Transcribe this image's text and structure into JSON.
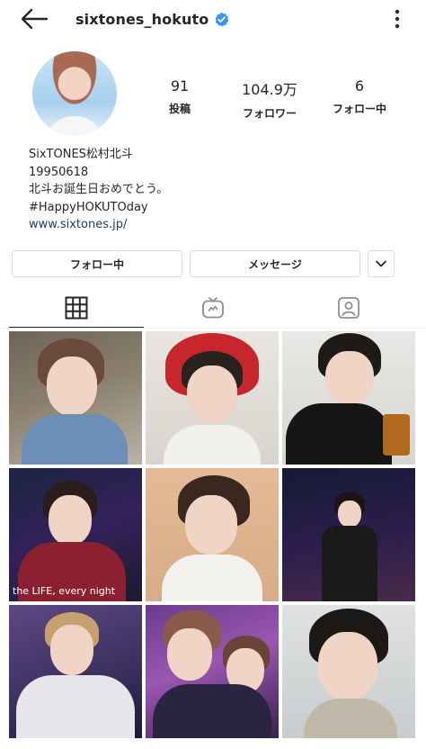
{
  "header": {
    "username": "sixtones_hokuto"
  },
  "stats": {
    "posts": {
      "value": "91",
      "label": "投稿"
    },
    "followers": {
      "value": "104.9万",
      "label": "フォロワー"
    },
    "following": {
      "value": "6",
      "label": "フォロー中"
    }
  },
  "bio": {
    "name": "SixTONES松村北斗",
    "birthdate": "19950618",
    "message": "北斗お誕生日おめでとう。",
    "hashtag": "#HappyHOKUTOday",
    "link": "www.sixtones.jp/"
  },
  "actions": {
    "follow_label": "フォロー中",
    "message_label": "メッセージ"
  },
  "tabs": {
    "icons": [
      "grid-icon",
      "igtv-icon",
      "tagged-icon"
    ]
  },
  "posts": [
    {
      "icon": "photo-portrait"
    },
    {
      "icon": "photo-red-hat"
    },
    {
      "icon": "photo-black-tee"
    },
    {
      "icon": "photo-stage-microphone",
      "caption": "the LIFE, every night"
    },
    {
      "icon": "photo-profile"
    },
    {
      "icon": "photo-concert-stage"
    },
    {
      "icon": "photo-performance-fur"
    },
    {
      "icon": "photo-performance-purple"
    },
    {
      "icon": "photo-closeup"
    }
  ],
  "colors": {
    "verified": "#3897f0",
    "link": "#1b3b6e",
    "border": "#dbdbdb",
    "text": "#262626"
  }
}
